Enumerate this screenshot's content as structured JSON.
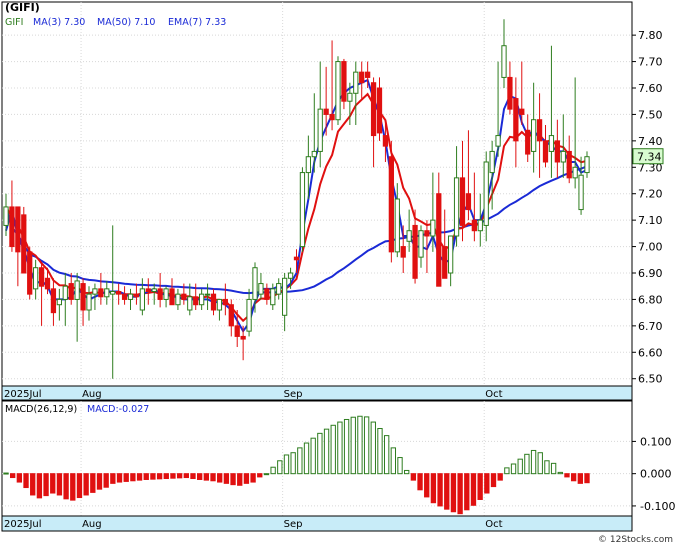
{
  "title": "(GIFI)",
  "legend": {
    "symbol": "GIFI",
    "ma3": "MA(3)  7.30",
    "ma50": "MA(50)  7.10",
    "ema7": "EMA(7)  7.33"
  },
  "last_price": "7.34",
  "macd_legend": {
    "params": "MACD(26,12,9)",
    "value": "MACD:-0.027"
  },
  "watermark": "© 12Stocks.com",
  "colors": {
    "up": "#2e7d1f",
    "down": "#e01010",
    "ma_blue": "#1a2ad6",
    "ema_red": "#e01010",
    "axis_strip": "#c8ecf8",
    "grid": "#d8d8d8",
    "legend_text": "#1a2ad6"
  },
  "chart_data": [
    {
      "type": "candlestick",
      "title": "(GIFI)",
      "months": [
        {
          "label": "2025Jul",
          "index": 0
        },
        {
          "label": "Aug",
          "index": 13
        },
        {
          "label": "Sep",
          "index": 47
        },
        {
          "label": "Oct",
          "index": 81
        }
      ],
      "y_ticks": [
        "6.50",
        "6.60",
        "6.70",
        "6.80",
        "6.90",
        "7.00",
        "7.10",
        "7.20",
        "7.30",
        "7.40",
        "7.50",
        "7.60",
        "7.70",
        "7.80"
      ],
      "ylim": [
        6.48,
        7.88
      ],
      "grid": true,
      "last_value": 7.34,
      "candles": [
        [
          7.08,
          7.2,
          7.04,
          7.15
        ],
        [
          7.15,
          7.25,
          6.98,
          7.0
        ],
        [
          7.15,
          7.15,
          6.85,
          6.98
        ],
        [
          7.12,
          7.15,
          6.9,
          6.9
        ],
        [
          6.98,
          7.0,
          6.8,
          6.82
        ],
        [
          6.84,
          6.95,
          6.8,
          6.92
        ],
        [
          6.92,
          6.94,
          6.7,
          6.85
        ],
        [
          6.88,
          6.92,
          6.82,
          6.84
        ],
        [
          6.84,
          6.88,
          6.7,
          6.75
        ],
        [
          6.78,
          6.84,
          6.72,
          6.8
        ],
        [
          6.8,
          6.9,
          6.7,
          6.85
        ],
        [
          6.86,
          6.9,
          6.78,
          6.8
        ],
        [
          6.8,
          6.9,
          6.64,
          6.87
        ],
        [
          6.86,
          6.88,
          6.7,
          6.76
        ],
        [
          6.76,
          6.85,
          6.72,
          6.82
        ],
        [
          6.82,
          6.86,
          6.76,
          6.84
        ],
        [
          6.84,
          6.9,
          6.78,
          6.81
        ],
        [
          6.81,
          6.87,
          6.78,
          6.84
        ],
        [
          6.82,
          7.08,
          6.5,
          6.83
        ],
        [
          6.83,
          6.86,
          6.78,
          6.82
        ],
        [
          6.82,
          6.85,
          6.78,
          6.8
        ],
        [
          6.8,
          6.84,
          6.76,
          6.82
        ],
        [
          6.82,
          6.86,
          6.78,
          6.81
        ],
        [
          6.76,
          6.88,
          6.74,
          6.84
        ],
        [
          6.84,
          6.88,
          6.78,
          6.83
        ],
        [
          6.83,
          6.86,
          6.78,
          6.84
        ],
        [
          6.84,
          6.9,
          6.77,
          6.8
        ],
        [
          6.8,
          6.85,
          6.77,
          6.84
        ],
        [
          6.84,
          6.88,
          6.78,
          6.78
        ],
        [
          6.78,
          6.84,
          6.76,
          6.82
        ],
        [
          6.82,
          6.86,
          6.78,
          6.8
        ],
        [
          6.76,
          6.86,
          6.74,
          6.81
        ],
        [
          6.81,
          6.86,
          6.76,
          6.78
        ],
        [
          6.78,
          6.84,
          6.76,
          6.82
        ],
        [
          6.82,
          6.86,
          6.76,
          6.82
        ],
        [
          6.82,
          6.84,
          6.74,
          6.76
        ],
        [
          6.76,
          6.8,
          6.72,
          6.8
        ],
        [
          6.8,
          6.86,
          6.74,
          6.78
        ],
        [
          6.78,
          6.8,
          6.66,
          6.7
        ],
        [
          6.7,
          6.76,
          6.62,
          6.66
        ],
        [
          6.66,
          6.7,
          6.57,
          6.65
        ],
        [
          6.68,
          6.84,
          6.66,
          6.8
        ],
        [
          6.8,
          6.94,
          6.75,
          6.92
        ],
        [
          6.82,
          6.9,
          6.8,
          6.86
        ],
        [
          6.84,
          6.86,
          6.78,
          6.8
        ],
        [
          6.78,
          6.86,
          6.76,
          6.84
        ],
        [
          6.82,
          6.88,
          6.8,
          6.86
        ],
        [
          6.74,
          6.9,
          6.68,
          6.88
        ],
        [
          6.88,
          6.92,
          6.84,
          6.9
        ],
        [
          6.96,
          6.99,
          6.9,
          6.95
        ],
        [
          7.0,
          7.3,
          6.98,
          7.28
        ],
        [
          7.28,
          7.42,
          7.18,
          7.34
        ],
        [
          7.34,
          7.58,
          7.28,
          7.36
        ],
        [
          7.36,
          7.7,
          7.3,
          7.52
        ],
        [
          7.52,
          7.68,
          7.42,
          7.5
        ],
        [
          7.5,
          7.78,
          7.44,
          7.48
        ],
        [
          7.48,
          7.72,
          7.46,
          7.7
        ],
        [
          7.7,
          7.71,
          7.52,
          7.55
        ],
        [
          7.55,
          7.62,
          7.46,
          7.58
        ],
        [
          7.58,
          7.7,
          7.46,
          7.66
        ],
        [
          7.66,
          7.7,
          7.56,
          7.62
        ],
        [
          7.66,
          7.7,
          7.6,
          7.64
        ],
        [
          7.62,
          7.64,
          7.3,
          7.42
        ],
        [
          7.6,
          7.64,
          7.4,
          7.43
        ],
        [
          7.42,
          7.48,
          7.32,
          7.38
        ],
        [
          7.34,
          7.4,
          6.94,
          6.98
        ],
        [
          6.98,
          7.24,
          6.96,
          7.18
        ],
        [
          7.0,
          7.08,
          6.9,
          6.96
        ],
        [
          7.02,
          7.14,
          6.98,
          7.06
        ],
        [
          7.08,
          7.14,
          6.86,
          6.88
        ],
        [
          6.96,
          7.08,
          6.92,
          7.06
        ],
        [
          7.06,
          7.1,
          6.9,
          7.04
        ],
        [
          7.04,
          7.28,
          6.98,
          7.1
        ],
        [
          7.2,
          7.28,
          6.85,
          6.85
        ],
        [
          7.0,
          7.14,
          6.88,
          6.88
        ],
        [
          6.9,
          7.04,
          6.85,
          7.04
        ],
        [
          7.04,
          7.38,
          7.0,
          7.26
        ],
        [
          7.26,
          7.4,
          7.02,
          7.08
        ],
        [
          7.2,
          7.44,
          7.1,
          7.14
        ],
        [
          7.1,
          7.28,
          7.02,
          7.06
        ],
        [
          7.06,
          7.2,
          7.0,
          7.1
        ],
        [
          7.08,
          7.36,
          7.02,
          7.32
        ],
        [
          7.28,
          7.4,
          7.14,
          7.36
        ],
        [
          7.38,
          7.7,
          7.34,
          7.42
        ],
        [
          7.64,
          7.86,
          7.6,
          7.76
        ],
        [
          7.64,
          7.7,
          7.5,
          7.52
        ],
        [
          7.56,
          7.64,
          7.3,
          7.4
        ],
        [
          7.52,
          7.7,
          7.46,
          7.5
        ],
        [
          7.44,
          7.5,
          7.32,
          7.35
        ],
        [
          7.36,
          7.62,
          7.28,
          7.48
        ],
        [
          7.48,
          7.58,
          7.26,
          7.4
        ],
        [
          7.4,
          7.46,
          7.3,
          7.32
        ],
        [
          7.36,
          7.76,
          7.26,
          7.42
        ],
        [
          7.4,
          7.48,
          7.26,
          7.32
        ],
        [
          7.32,
          7.5,
          7.26,
          7.36
        ],
        [
          7.36,
          7.42,
          7.24,
          7.26
        ],
        [
          7.26,
          7.64,
          7.22,
          7.3
        ],
        [
          7.14,
          7.34,
          7.12,
          7.27
        ],
        [
          7.28,
          7.36,
          7.26,
          7.34
        ]
      ],
      "ma3": [
        7.06,
        7.14,
        7.04,
        6.99,
        6.92,
        6.86,
        6.87,
        6.85,
        6.8,
        6.8,
        6.8,
        6.81,
        6.84,
        6.82,
        6.8,
        6.81,
        6.82,
        6.83,
        6.83,
        6.83,
        6.82,
        6.81,
        6.81,
        6.82,
        6.83,
        6.84,
        6.82,
        6.82,
        6.81,
        6.81,
        6.8,
        6.8,
        6.8,
        6.8,
        6.8,
        6.79,
        6.79,
        6.78,
        6.76,
        6.72,
        6.68,
        6.71,
        6.79,
        6.84,
        6.84,
        6.84,
        6.85,
        6.84,
        6.86,
        6.9,
        7.05,
        7.18,
        7.32,
        7.4,
        7.45,
        7.5,
        7.55,
        7.58,
        7.6,
        7.61,
        7.62,
        7.63,
        7.56,
        7.5,
        7.4,
        7.26,
        7.16,
        7.04,
        7.04,
        7.0,
        7.0,
        6.99,
        7.04,
        6.97,
        6.94,
        6.95,
        7.06,
        7.13,
        7.16,
        7.1,
        7.1,
        7.16,
        7.26,
        7.37,
        7.52,
        7.57,
        7.56,
        7.47,
        7.42,
        7.44,
        7.41,
        7.4,
        7.38,
        7.36,
        7.36,
        7.32,
        7.32,
        7.28,
        7.29
      ]
    },
    {
      "type": "bar",
      "title": "MACD(26,12,9)",
      "y_ticks": [
        "0.100",
        "0.000",
        "-0.100"
      ],
      "ylim": [
        -0.125,
        0.185
      ],
      "last_value": -0.027,
      "values": [
        0.002,
        -0.012,
        -0.026,
        -0.043,
        -0.066,
        -0.075,
        -0.068,
        -0.06,
        -0.066,
        -0.078,
        -0.082,
        -0.074,
        -0.066,
        -0.058,
        -0.048,
        -0.042,
        -0.03,
        -0.026,
        -0.024,
        -0.022,
        -0.02,
        -0.018,
        -0.017,
        -0.016,
        -0.015,
        -0.014,
        -0.013,
        -0.012,
        -0.015,
        -0.018,
        -0.02,
        -0.022,
        -0.026,
        -0.03,
        -0.034,
        -0.036,
        -0.03,
        -0.026,
        -0.01,
        0.0,
        0.02,
        0.04,
        0.058,
        0.065,
        0.08,
        0.095,
        0.11,
        0.125,
        0.138,
        0.15,
        0.16,
        0.168,
        0.175,
        0.178,
        0.176,
        0.16,
        0.14,
        0.118,
        0.08,
        0.05,
        0.01,
        -0.02,
        -0.05,
        -0.072,
        -0.09,
        -0.1,
        -0.11,
        -0.118,
        -0.124,
        -0.112,
        -0.098,
        -0.08,
        -0.06,
        -0.04,
        -0.02,
        0.018,
        0.03,
        0.045,
        0.06,
        0.072,
        0.065,
        0.04,
        0.032,
        0.004,
        -0.01,
        -0.022,
        -0.03,
        -0.028
      ]
    }
  ]
}
